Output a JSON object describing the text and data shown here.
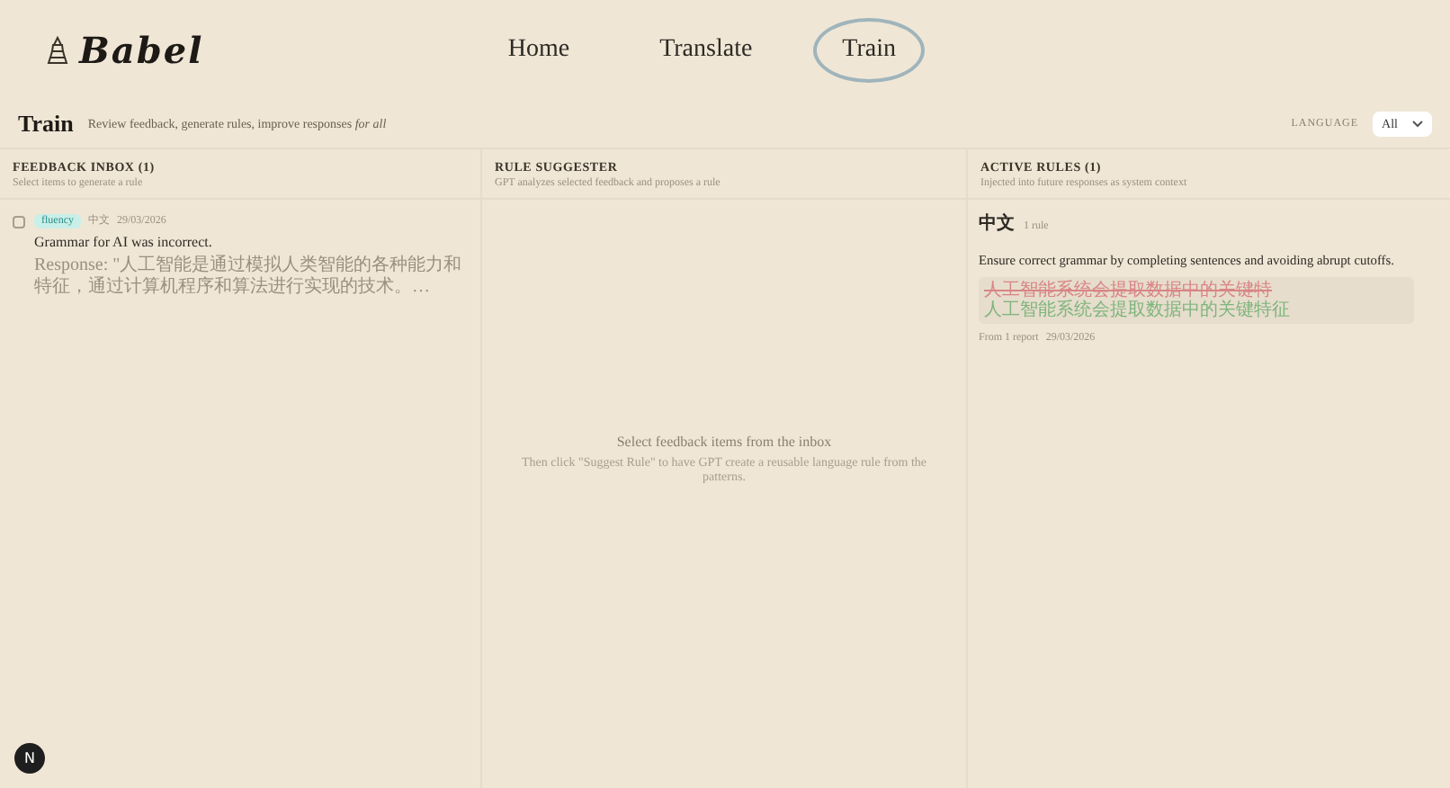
{
  "logo": {
    "text": "Babel"
  },
  "nav": [
    {
      "label": "Home",
      "selected": false
    },
    {
      "label": "Translate",
      "selected": false
    },
    {
      "label": "Train",
      "selected": true
    }
  ],
  "page": {
    "title": "Train",
    "subtitle": "Review feedback, generate rules, improve responses *for all*",
    "language_label": "LANGUAGE",
    "language_value": "All"
  },
  "inbox": {
    "title": "FEEDBACK INBOX (1)",
    "subtitle": "Select items to generate a rule",
    "items": [
      {
        "checked": false,
        "tag": "fluency",
        "language": "中文",
        "date": "29/03/2026",
        "title": "Grammar for AI was incorrect.",
        "response": "Response: \"人工智能是通过模拟人类智能的各种能力和特征，通过计算机程序和算法进行实现的技术。…"
      }
    ]
  },
  "suggester": {
    "title": "RULE SUGGESTER",
    "subtitle": "GPT analyzes selected feedback and proposes a rule",
    "empty_title": "Select feedback items from the inbox",
    "empty_text": "Then click \"Suggest Rule\" to have GPT create a reusable language rule from the patterns."
  },
  "rules": {
    "title": "ACTIVE RULES (1)",
    "subtitle": "Injected into future responses as system context",
    "groups": [
      {
        "language": "中文",
        "count": "1 rule",
        "rules": [
          {
            "text": "Ensure correct grammar by completing sentences and avoiding abrupt cutoffs.",
            "diff": [
              {
                "kind": "removed",
                "text": "人工智能系统会提取数据中的关键特"
              },
              {
                "kind": "added",
                "text": "人工智能系统会提取数据中的关键特征"
              }
            ],
            "source": "From 1 report",
            "date": "29/03/2026"
          }
        ]
      }
    ]
  },
  "dev_badge": "N"
}
